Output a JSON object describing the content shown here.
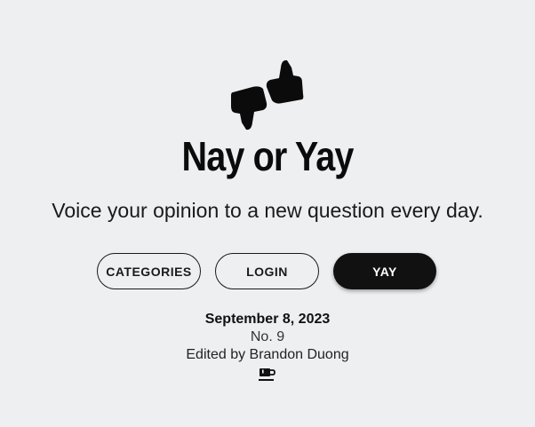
{
  "app": {
    "title": "Nay or Yay",
    "tagline": "Voice your opinion to a new question every day.",
    "logo_icon": "thumbs-down-up-icon"
  },
  "nav": {
    "categories_label": "CATEGORIES",
    "login_label": "LOGIN",
    "yay_label": "YAY"
  },
  "issue": {
    "date": "September 8, 2023",
    "number": "No. 9",
    "editor": "Edited by Brandon Duong",
    "support_icon": "coffee-cup-icon"
  },
  "colors": {
    "background": "#eeeff1",
    "primary": "#111111",
    "primary_text": "#ffffff"
  }
}
